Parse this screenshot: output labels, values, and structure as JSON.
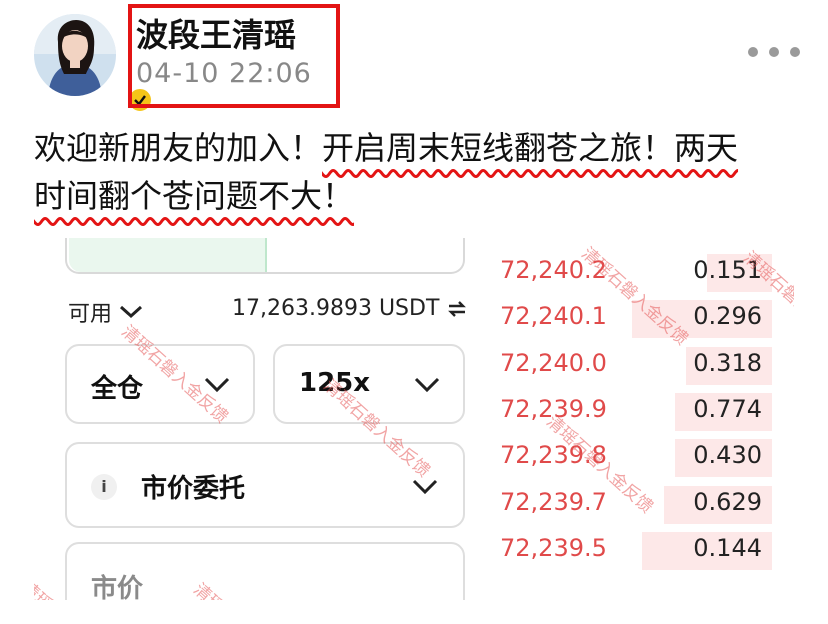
{
  "post": {
    "username": "波段王清瑶",
    "timestamp": "04-10 22:06",
    "text_line1_a": "欢迎新朋友的加入！",
    "text_line1_b": "开启周末短线翻苍之旅！两天",
    "text_line2": "时间翻个苍问题不大！"
  },
  "trade_panel": {
    "available_label": "可用",
    "balance": "17,263.9893 USDT",
    "margin_mode": "全仓",
    "leverage": "125x",
    "info_badge": "i",
    "order_type": "市价委托",
    "price_placeholder": "市价"
  },
  "order_book": [
    {
      "price": "72,240.2",
      "qty": "0.151"
    },
    {
      "price": "72,240.1",
      "qty": "0.296"
    },
    {
      "price": "72,240.0",
      "qty": "0.318"
    },
    {
      "price": "72,239.9",
      "qty": "0.774"
    },
    {
      "price": "72,239.8",
      "qty": "0.430"
    },
    {
      "price": "72,239.7",
      "qty": "0.629"
    },
    {
      "price": "72,239.5",
      "qty": "0.144"
    }
  ],
  "order_book_depth_fraction": [
    0.24,
    0.52,
    0.32,
    0.36,
    0.36,
    0.4,
    0.48
  ],
  "watermark": "清瑶石磐入金反馈",
  "watermark_partial": "清瑶",
  "icons": {
    "more": "more-horizontal-icon",
    "verified": "verified-badge-icon",
    "chevron": "chevron-down-icon",
    "swap": "swap-arrows-icon",
    "info": "info-icon"
  },
  "colors": {
    "highlight_border": "#e31414",
    "wavy_underline": "#e31414",
    "ask_price": "#e04a4a",
    "depth_bar": "#fde8e8",
    "verified_badge": "#f5c518",
    "timestamp": "#888888"
  }
}
